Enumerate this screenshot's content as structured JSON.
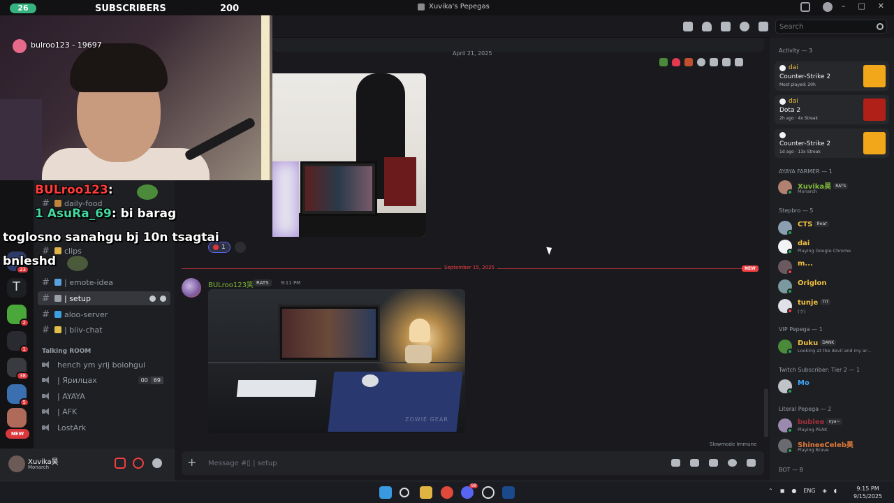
{
  "window": {
    "title": "Xuvika's Pepegas"
  },
  "stream_overlay": {
    "sub_count": "26",
    "sub_label": "SUBSCRIBERS",
    "sub_goal": "200",
    "cam_name": "bulroo123 - 19697",
    "chat": [
      {
        "name": "BULroo123",
        "text": ""
      },
      {
        "name": "1 AsuRa_69",
        "text": "bi barag"
      },
      {
        "name": "",
        "text": "toglosno sanahgu bj 10n tsagtai"
      },
      {
        "name": "",
        "text": "bnleshd"
      }
    ]
  },
  "server_rail": {
    "new_label": "NEW",
    "badges": [
      "23",
      "2",
      "1",
      "38",
      "5",
      "2"
    ]
  },
  "channels": {
    "items": [
      {
        "label": "daily-food",
        "emoji_color": "#c0853a"
      },
      {
        "label": "clips",
        "emoji_color": "#e0b44a"
      },
      {
        "label": "| emote-idea",
        "emoji_color": "#5aa0e0"
      },
      {
        "label": "| setup",
        "emoji_color": "#9aa0a8"
      },
      {
        "label": "aloo-server",
        "emoji_color": "#3aa0e0"
      },
      {
        "label": "| biiv-chat",
        "emoji_color": "#e0c04a"
      }
    ],
    "voice_category": "Talking ROOM",
    "voice": [
      {
        "label": "hench ym yrij bolohgui"
      },
      {
        "label": "| Ярилцах"
      },
      {
        "label": "| AYAYA"
      },
      {
        "label": "| AFK"
      },
      {
        "label": "LostArk"
      }
    ],
    "voice_counts": [
      "00",
      "69"
    ]
  },
  "user_panel": {
    "name": "Xuvika昊",
    "status": "Monarch"
  },
  "chat": {
    "date_top": "April 21, 2025",
    "reaction_count": "1",
    "divider_date": "September 15, 2025",
    "new_label": "NEW",
    "author": "BULroo123笑",
    "author_tag": "RATS",
    "time": "9:11 PM",
    "photo_brand": "ZOWIE GEAR",
    "slowmode": "Slowmode Immune",
    "composer_placeholder": "Message #▯ | setup"
  },
  "search": {
    "placeholder": "Search"
  },
  "members": {
    "activity_header": "Activity — 3",
    "activities": [
      {
        "user": "dai",
        "game": "Counter-Strike 2",
        "meta": "Most played: 20h",
        "art_color": "#f2a71a"
      },
      {
        "user": "dai",
        "game": "Dota 2",
        "meta": "2h ago · 4x Streak",
        "art_color": "#b02018"
      },
      {
        "user": "",
        "game": "Counter-Strike 2",
        "meta": "1d ago · 13x Streak",
        "art_color": "#f2a71a"
      }
    ],
    "groups": [
      {
        "header": "AYAYA FARMER — 1"
      },
      {
        "header": "Stepbro — 5"
      },
      {
        "header": "VIP Pepega — 1"
      },
      {
        "header": "Twitch Subscriber: Tier 2 — 1"
      },
      {
        "header": "Literal Pepega — 2"
      },
      {
        "header": "BOT — 8"
      }
    ],
    "list": [
      {
        "name": "Xuvika昊",
        "tag": "RATS",
        "sub": "Monarch",
        "color": "#7fb83a"
      },
      {
        "name": "CTS",
        "tag": "Янаг",
        "sub": "",
        "color": "#f0c040"
      },
      {
        "name": "dai",
        "tag": "",
        "sub": "Playing Google Chrome",
        "color": "#f0c040"
      },
      {
        "name": "m...",
        "tag": "",
        "sub": "",
        "color": "#f0c040"
      },
      {
        "name": "Origlon",
        "tag": "",
        "sub": "",
        "color": "#f0c040"
      },
      {
        "name": "tunje",
        "tag": "TIT",
        "sub": "(ツ)",
        "color": "#f0c040"
      },
      {
        "name": "Duku",
        "tag": "DANK",
        "sub": "Looking at the devil and my ar...",
        "color": "#f0c040"
      },
      {
        "name": "Mo",
        "tag": "",
        "sub": "",
        "color": "#3ea8ff"
      },
      {
        "name": "bublee",
        "tag": "nya~",
        "sub": "Playing PEAK",
        "color": "#a0303a"
      },
      {
        "name": "ShineeCeleb昊",
        "tag": "",
        "sub": "Playing Brave",
        "color": "#e07a3a"
      }
    ]
  },
  "taskbar": {
    "lang": "ENG",
    "time": "9:15 PM",
    "date": "9/15/2025",
    "discord_badge": "98"
  }
}
